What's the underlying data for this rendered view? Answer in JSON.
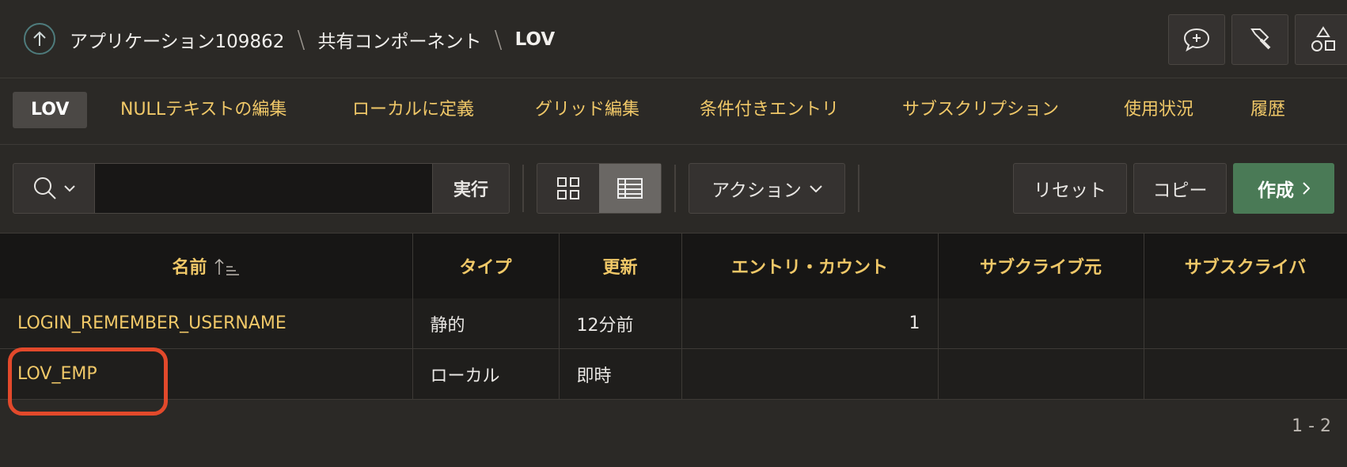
{
  "breadcrumb": {
    "items": [
      "アプリケーション109862",
      "共有コンポーネント"
    ],
    "current": "LOV"
  },
  "topbar_icons": [
    "comment-add-icon",
    "flashlight-icon",
    "shapes-icon"
  ],
  "tabs": [
    "LOV",
    "NULLテキストの編集",
    "ローカルに定義",
    "グリッド編集",
    "条件付きエントリ",
    "サブスクリプション",
    "使用状況",
    "履歴"
  ],
  "toolbar": {
    "search_value": "",
    "go_label": "実行",
    "actions_label": "アクション",
    "reset_label": "リセット",
    "copy_label": "コピー",
    "create_label": "作成"
  },
  "grid": {
    "columns": [
      "名前",
      "タイプ",
      "更新",
      "エントリ・カウント",
      "サブクライブ元",
      "サブスクライバ"
    ],
    "rows": [
      {
        "name": "LOGIN_REMEMBER_USERNAME",
        "type": "静的",
        "updated": "12分前",
        "count": "1",
        "subscribed_from": "",
        "subscribers": ""
      },
      {
        "name": "LOV_EMP",
        "type": "ローカル",
        "updated": "即時",
        "count": "",
        "subscribed_from": "",
        "subscribers": ""
      }
    ]
  },
  "pagination": "1 - 2",
  "colors": {
    "accent": "#f0c868",
    "create": "#4a7a56",
    "highlight": "#e2492b"
  }
}
